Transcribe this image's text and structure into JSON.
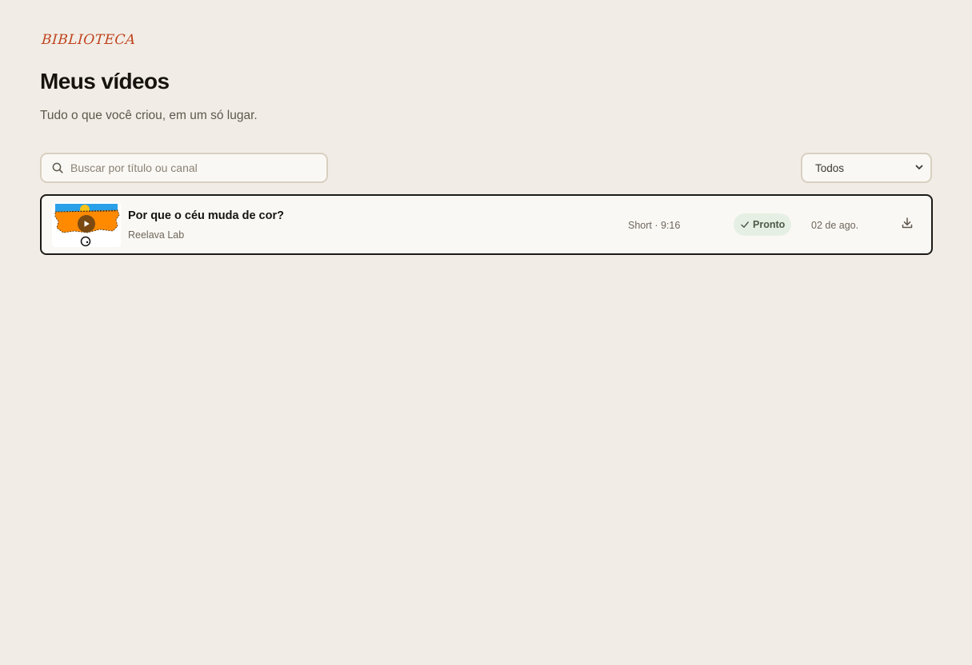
{
  "header": {
    "eyebrow": "BIBLIOTECA",
    "title": "Meus vídeos",
    "subtitle": "Tudo o que você criou, em um só lugar."
  },
  "search": {
    "placeholder": "Buscar por título ou canal",
    "value": "",
    "icon": "search-icon"
  },
  "filter": {
    "selected": "Todos",
    "icon": "chevron-down-icon"
  },
  "videos": [
    {
      "title": "Por que o céu muda de cor?",
      "channel": "Reelava Lab",
      "format": "Short · 9:16",
      "status": "Pronto",
      "date": "02 de ago.",
      "thumbnail_icon": "play-icon",
      "action_icon": "download-icon"
    }
  ],
  "colors": {
    "background": "#f1ede6",
    "accent": "#c0421d",
    "status_bg": "#e6efe3",
    "thumb_orange": "#ff8a00",
    "thumb_sky": "#2aa0e8"
  }
}
